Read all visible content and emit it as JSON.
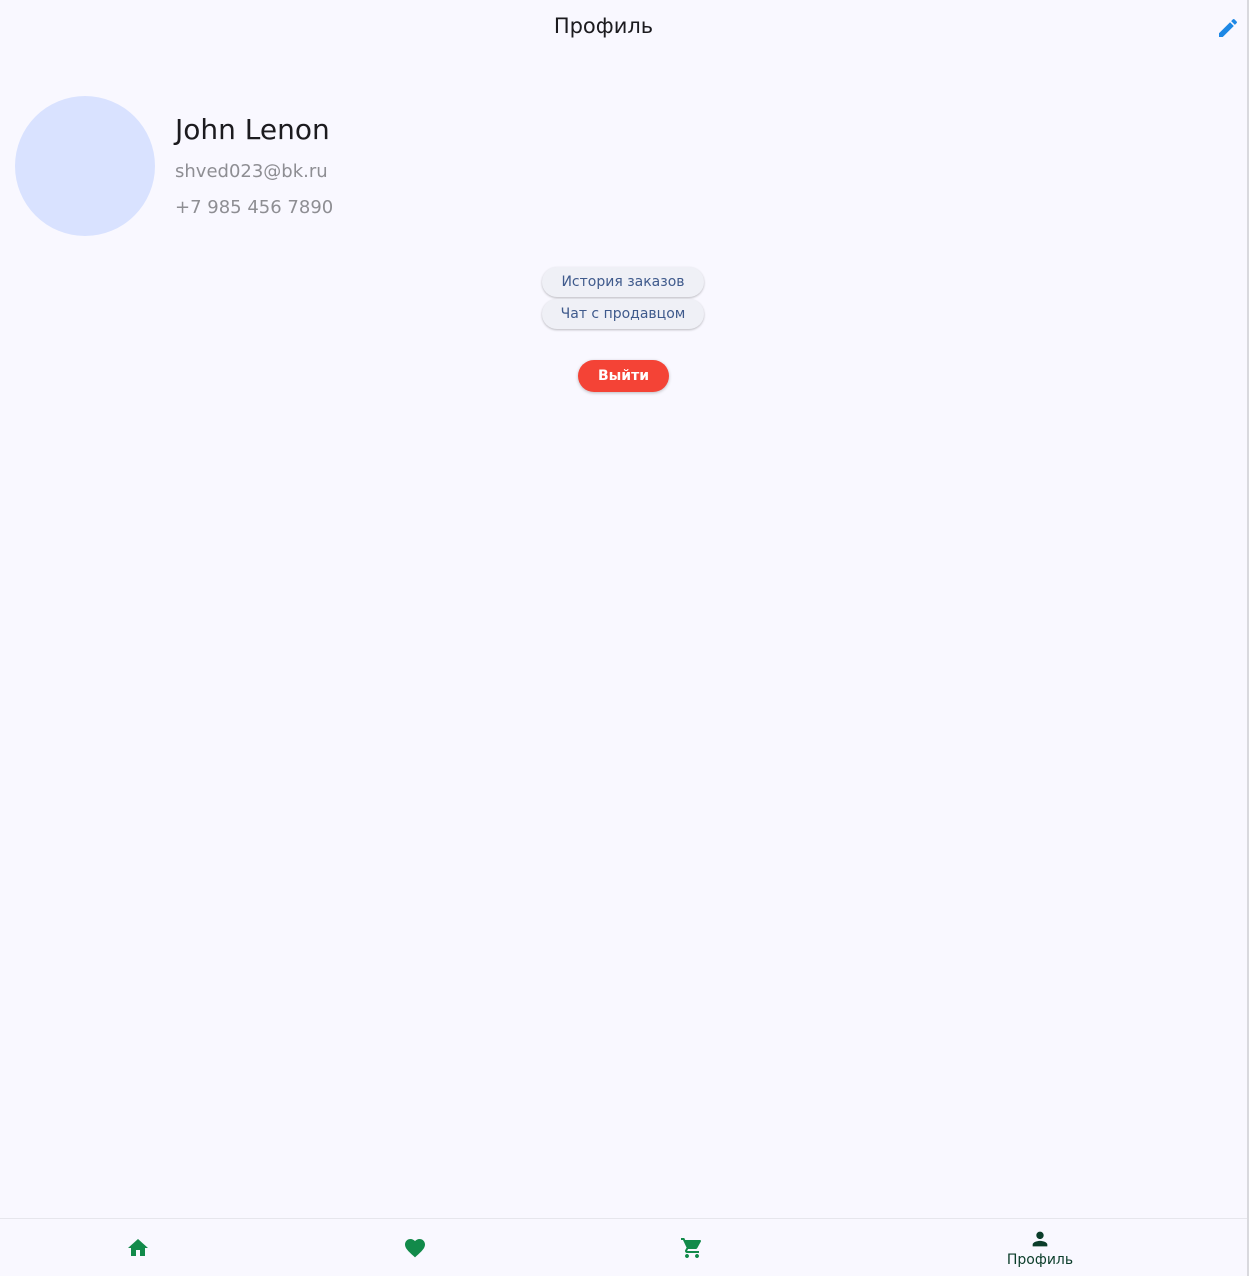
{
  "app_bar": {
    "title": "Профиль",
    "edit_icon": "pencil-icon",
    "edit_color": "#1e88e5"
  },
  "profile": {
    "name": "John Lenon",
    "email": "shved023@bk.ru",
    "phone": "+7 985 456 7890",
    "avatar_color": "#d9e2ff"
  },
  "actions": {
    "order_history": "История заказов",
    "chat_with_seller": "Чат с продавцом",
    "logout": "Выйти",
    "logout_color": "#f44336"
  },
  "bottom_nav": {
    "items": [
      {
        "icon": "home-icon",
        "label": "",
        "active": false
      },
      {
        "icon": "heart-icon",
        "label": "",
        "active": false
      },
      {
        "icon": "cart-icon",
        "label": "",
        "active": false
      },
      {
        "icon": "person-icon",
        "label": "Профиль",
        "active": true
      }
    ],
    "icon_color": "#128a4a",
    "active_color": "#0b3d2a"
  }
}
